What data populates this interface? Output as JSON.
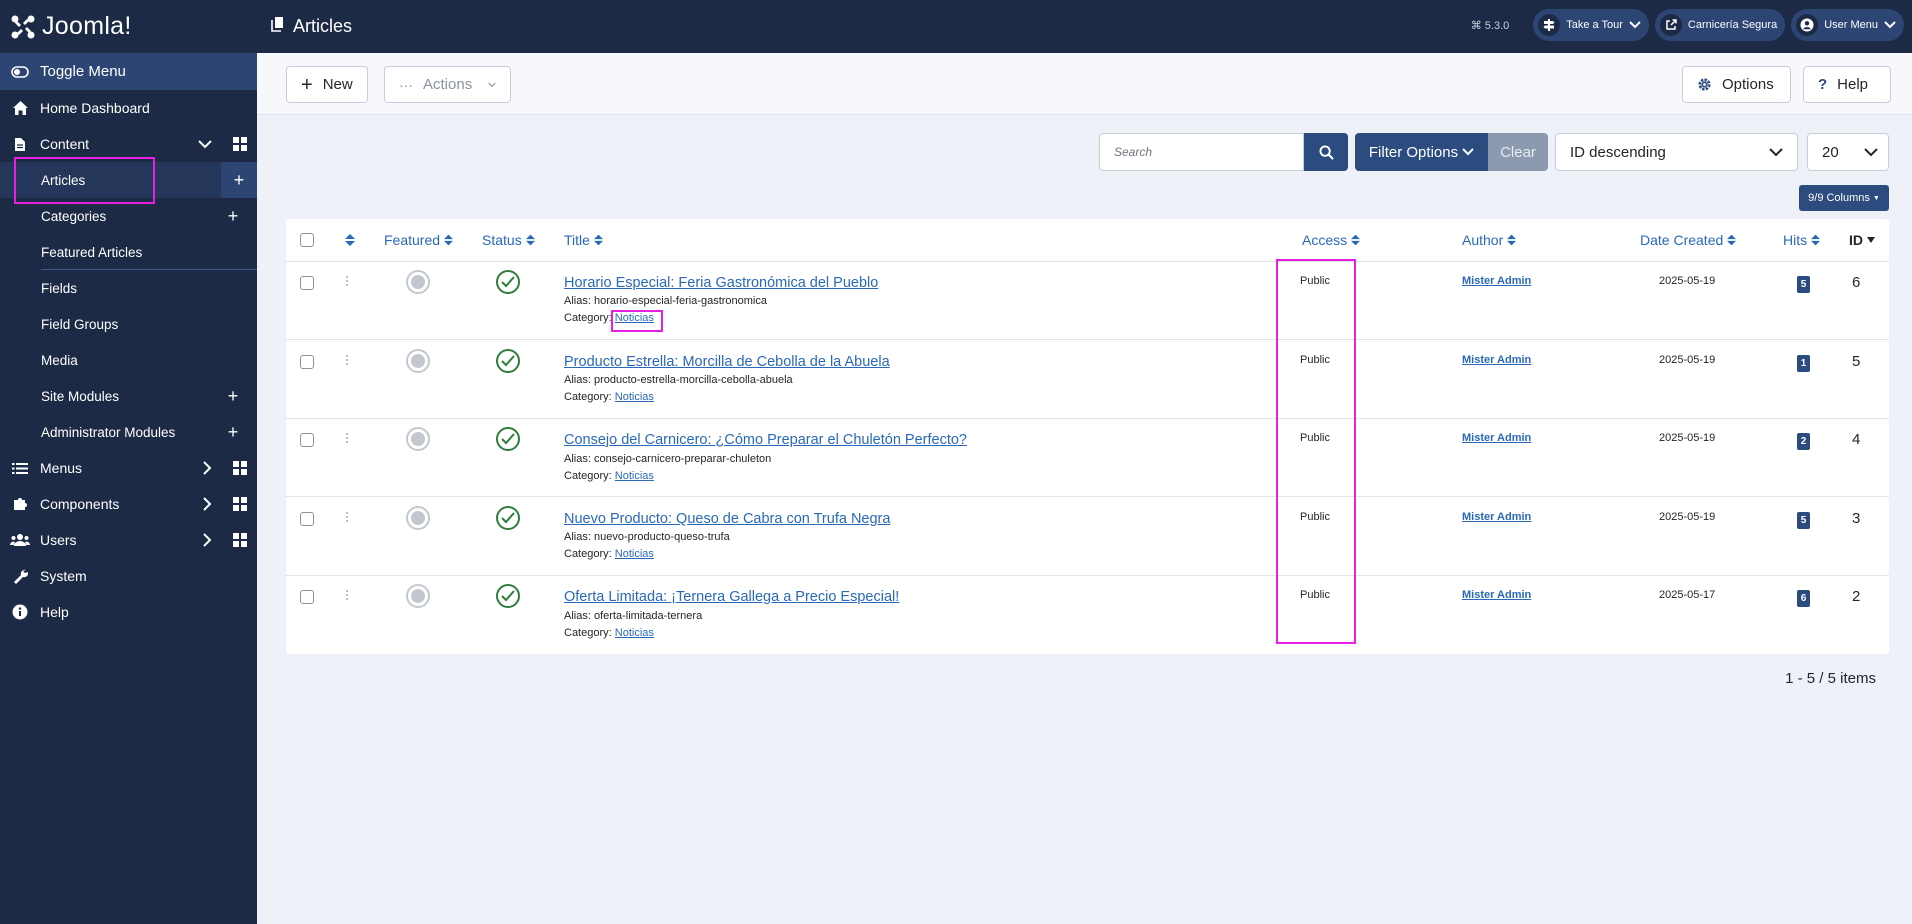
{
  "app": {
    "brand": "Joomla!",
    "page_title": "Articles",
    "version": "5.3.0"
  },
  "top_buttons": {
    "tour": "Take a Tour",
    "site": "Carnicería Segura",
    "user": "User Menu"
  },
  "sidebar": {
    "toggle": "Toggle Menu",
    "home": "Home Dashboard",
    "content": "Content",
    "items": [
      "Articles",
      "Categories",
      "Featured Articles",
      "Fields",
      "Field Groups",
      "Media",
      "Site Modules",
      "Administrator Modules"
    ],
    "menus": "Menus",
    "components": "Components",
    "users": "Users",
    "system": "System",
    "help": "Help"
  },
  "toolbar": {
    "new": "New",
    "actions": "Actions",
    "options": "Options",
    "help": "Help"
  },
  "filters": {
    "search_placeholder": "Search",
    "filter_options": "Filter Options",
    "clear": "Clear",
    "ordering": "ID descending",
    "limit": "20",
    "columns": "9/9 Columns"
  },
  "table": {
    "headers": {
      "featured": "Featured",
      "status": "Status",
      "title": "Title",
      "access": "Access",
      "author": "Author",
      "date": "Date Created",
      "hits": "Hits",
      "id": "ID"
    },
    "alias_label": "Alias:",
    "category_label": "Category:",
    "rows": [
      {
        "title": "Horario Especial: Feria Gastronómica del Pueblo",
        "alias": "horario-especial-feria-gastronomica",
        "category": "Noticias",
        "access": "Public",
        "author": "Mister Admin",
        "date": "2025-05-19",
        "hits": "5",
        "id": "6"
      },
      {
        "title": "Producto Estrella: Morcilla de Cebolla de la Abuela",
        "alias": "producto-estrella-morcilla-cebolla-abuela",
        "category": "Noticias",
        "access": "Public",
        "author": "Mister Admin",
        "date": "2025-05-19",
        "hits": "1",
        "id": "5"
      },
      {
        "title": "Consejo del Carnicero: ¿Cómo Preparar el Chuletón Perfecto?",
        "alias": "consejo-carnicero-preparar-chuleton",
        "category": "Noticias",
        "access": "Public",
        "author": "Mister Admin",
        "date": "2025-05-19",
        "hits": "2",
        "id": "4"
      },
      {
        "title": "Nuevo Producto: Queso de Cabra con Trufa Negra",
        "alias": "nuevo-producto-queso-trufa",
        "category": "Noticias",
        "access": "Public",
        "author": "Mister Admin",
        "date": "2025-05-19",
        "hits": "5",
        "id": "3"
      },
      {
        "title": "Oferta Limitada: ¡Ternera Gallega a Precio Especial!",
        "alias": "oferta-limitada-ternera",
        "category": "Noticias",
        "access": "Public",
        "author": "Mister Admin",
        "date": "2025-05-17",
        "hits": "6",
        "id": "2"
      }
    ]
  },
  "pagination": "1 - 5 / 5 items"
}
